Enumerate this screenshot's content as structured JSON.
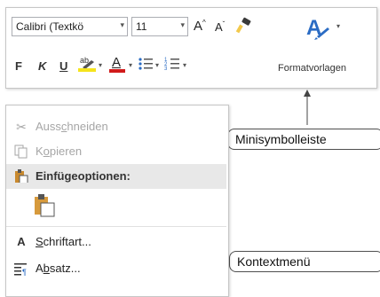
{
  "mini_toolbar": {
    "font_name": "Calibri (Textkö",
    "font_size": "11",
    "grow_font_label": "A",
    "shrink_font_label": "A",
    "bold_label": "F",
    "italic_label": "K",
    "underline_label": "U",
    "highlight_label": "ab",
    "font_color_label": "A",
    "format_styles_label": "Formatvorlagen"
  },
  "callouts": {
    "minitoolbar": "Minisymbolleiste",
    "contextmenu": "Kontextmenü"
  },
  "context_menu": {
    "items": [
      {
        "pre": "Auss",
        "acc": "c",
        "post": "hneiden",
        "icon": "scissors-icon",
        "enabled": false
      },
      {
        "pre": "K",
        "acc": "o",
        "post": "pieren",
        "icon": "copy-icon",
        "enabled": false
      },
      {
        "label": "Einfügeoptionen:",
        "icon": "paste-icon",
        "section": true
      },
      {
        "icon": "paste-keep-formatting-icon"
      },
      {
        "pre": "",
        "acc": "S",
        "post": "chriftart...",
        "icon": "font-icon",
        "enabled": true
      },
      {
        "pre": "A",
        "acc": "b",
        "post": "satz...",
        "icon": "paragraph-icon",
        "enabled": true
      }
    ]
  },
  "colors": {
    "highlight": "#f5e41c",
    "font_color": "#d11b1b",
    "style_accent": "#2b6cc4"
  }
}
